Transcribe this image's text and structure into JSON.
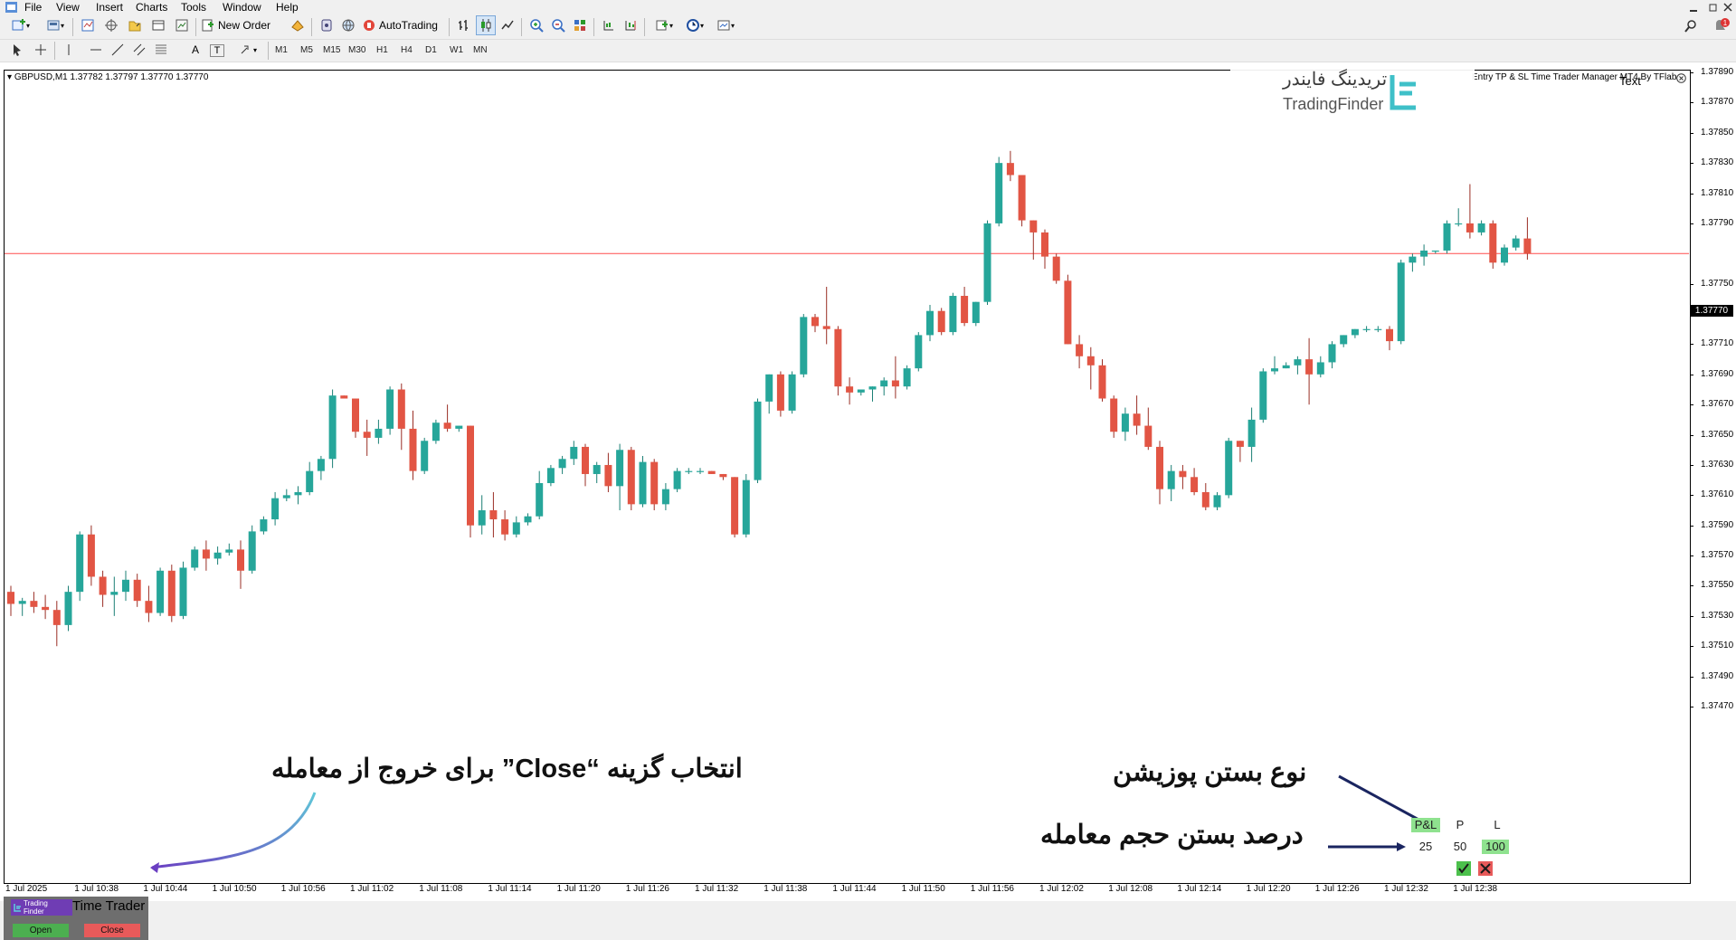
{
  "menu": [
    "File",
    "View",
    "Insert",
    "Charts",
    "Tools",
    "Window",
    "Help"
  ],
  "toolbar": {
    "new_order": "New Order",
    "autotrading": "AutoTrading",
    "draw_text_a": "A",
    "draw_text_t": "T"
  },
  "timeframes": [
    "M1",
    "M5",
    "M15",
    "M30",
    "H1",
    "H4",
    "D1",
    "W1",
    "MN"
  ],
  "chart": {
    "symbol_header": "GBPUSD,M1  1.37782 1.37797 1.37770 1.37770",
    "indicator_name": "Entry TP & SL Time Trader Manager MT4 By TFlab",
    "text_label": "Text",
    "current_price": "1.37770",
    "price_line_color": "#ff4d4d",
    "bull_color": "#26a69a",
    "bear_color": "#e25544",
    "y_labels": [
      "1.37890",
      "1.37870",
      "1.37850",
      "1.37830",
      "1.37810",
      "1.37790",
      "1.37750",
      "1.37730",
      "1.37710",
      "1.37690",
      "1.37670",
      "1.37650",
      "1.37630",
      "1.37610",
      "1.37590",
      "1.37570",
      "1.37550",
      "1.37530",
      "1.37510",
      "1.37490",
      "1.37470"
    ],
    "x_labels": [
      "1 Jul 2025",
      "1 Jul 10:38",
      "1 Jul 10:44",
      "1 Jul 10:50",
      "1 Jul 10:56",
      "1 Jul 11:02",
      "1 Jul 11:08",
      "1 Jul 11:14",
      "1 Jul 11:20",
      "1 Jul 11:26",
      "1 Jul 11:32",
      "1 Jul 11:38",
      "1 Jul 11:44",
      "1 Jul 11:50",
      "1 Jul 11:56",
      "1 Jul 12:02",
      "1 Jul 12:08",
      "1 Jul 12:14",
      "1 Jul 12:20",
      "1 Jul 12:26",
      "1 Jul 12:32",
      "1 Jul 12:38"
    ]
  },
  "chart_data": {
    "type": "candlestick",
    "candles": [
      [
        1.37546,
        1.3755,
        1.3753,
        1.37538
      ],
      [
        1.37538,
        1.37542,
        1.3753,
        1.3754
      ],
      [
        1.3754,
        1.37546,
        1.37532,
        1.37536
      ],
      [
        1.37536,
        1.37544,
        1.37528,
        1.37534
      ],
      [
        1.37534,
        1.3754,
        1.3751,
        1.37524
      ],
      [
        1.37524,
        1.3755,
        1.3752,
        1.37546
      ],
      [
        1.37546,
        1.37586,
        1.3754,
        1.37584
      ],
      [
        1.37584,
        1.3759,
        1.3755,
        1.37556
      ],
      [
        1.37556,
        1.3756,
        1.37536,
        1.37544
      ],
      [
        1.37544,
        1.37556,
        1.3753,
        1.37546
      ],
      [
        1.37546,
        1.3756,
        1.3754,
        1.37554
      ],
      [
        1.37554,
        1.37558,
        1.37536,
        1.3754
      ],
      [
        1.3754,
        1.3755,
        1.37526,
        1.37532
      ],
      [
        1.37532,
        1.37562,
        1.3753,
        1.3756
      ],
      [
        1.3756,
        1.37564,
        1.37526,
        1.3753
      ],
      [
        1.3753,
        1.37566,
        1.37528,
        1.37562
      ],
      [
        1.37562,
        1.37576,
        1.3756,
        1.37574
      ],
      [
        1.37574,
        1.3758,
        1.3756,
        1.37568
      ],
      [
        1.37568,
        1.37576,
        1.37564,
        1.37572
      ],
      [
        1.37572,
        1.37578,
        1.3757,
        1.37574
      ],
      [
        1.37574,
        1.3758,
        1.37548,
        1.3756
      ],
      [
        1.3756,
        1.3759,
        1.37558,
        1.37586
      ],
      [
        1.37586,
        1.37596,
        1.37584,
        1.37594
      ],
      [
        1.37594,
        1.37612,
        1.3759,
        1.37608
      ],
      [
        1.37608,
        1.37614,
        1.37606,
        1.3761
      ],
      [
        1.3761,
        1.37616,
        1.37604,
        1.37612
      ],
      [
        1.37612,
        1.37632,
        1.3761,
        1.37626
      ],
      [
        1.37626,
        1.37636,
        1.3762,
        1.37634
      ],
      [
        1.37634,
        1.3768,
        1.37628,
        1.37676
      ],
      [
        1.37676,
        1.37676,
        1.37674,
        1.37674
      ],
      [
        1.37674,
        1.37674,
        1.37648,
        1.37652
      ],
      [
        1.37652,
        1.3766,
        1.37636,
        1.37648
      ],
      [
        1.37648,
        1.3766,
        1.37644,
        1.37654
      ],
      [
        1.37654,
        1.37682,
        1.3765,
        1.3768
      ],
      [
        1.3768,
        1.37684,
        1.3764,
        1.37654
      ],
      [
        1.37654,
        1.37666,
        1.3762,
        1.37626
      ],
      [
        1.37626,
        1.37648,
        1.37624,
        1.37646
      ],
      [
        1.37646,
        1.3766,
        1.37644,
        1.37658
      ],
      [
        1.37658,
        1.3767,
        1.37652,
        1.37654
      ],
      [
        1.37654,
        1.37656,
        1.37652,
        1.37656
      ],
      [
        1.37656,
        1.37656,
        1.37582,
        1.3759
      ],
      [
        1.3759,
        1.3761,
        1.37584,
        1.376
      ],
      [
        1.376,
        1.37612,
        1.37582,
        1.37594
      ],
      [
        1.37594,
        1.376,
        1.3758,
        1.37584
      ],
      [
        1.37584,
        1.37596,
        1.37582,
        1.37592
      ],
      [
        1.37592,
        1.37598,
        1.3759,
        1.37596
      ],
      [
        1.37596,
        1.37626,
        1.37594,
        1.37618
      ],
      [
        1.37618,
        1.3763,
        1.37616,
        1.37628
      ],
      [
        1.37628,
        1.37636,
        1.37624,
        1.37634
      ],
      [
        1.37634,
        1.37646,
        1.3763,
        1.37642
      ],
      [
        1.37642,
        1.37644,
        1.37616,
        1.37624
      ],
      [
        1.37624,
        1.37632,
        1.37618,
        1.3763
      ],
      [
        1.3763,
        1.37638,
        1.37612,
        1.37616
      ],
      [
        1.37616,
        1.37644,
        1.376,
        1.3764
      ],
      [
        1.3764,
        1.37642,
        1.376,
        1.37604
      ],
      [
        1.37604,
        1.37636,
        1.37602,
        1.37632
      ],
      [
        1.37632,
        1.37634,
        1.376,
        1.37604
      ],
      [
        1.37604,
        1.37618,
        1.376,
        1.37614
      ],
      [
        1.37614,
        1.37628,
        1.37612,
        1.37626
      ],
      [
        1.37626,
        1.37628,
        1.37624,
        1.37626
      ],
      [
        1.37626,
        1.37628,
        1.37624,
        1.37626
      ],
      [
        1.37626,
        1.37626,
        1.37624,
        1.37624
      ],
      [
        1.37624,
        1.37624,
        1.3762,
        1.37622
      ],
      [
        1.37622,
        1.37622,
        1.37582,
        1.37584
      ],
      [
        1.37584,
        1.37624,
        1.37582,
        1.3762
      ],
      [
        1.3762,
        1.37674,
        1.37618,
        1.37672
      ],
      [
        1.37672,
        1.3769,
        1.37664,
        1.3769
      ],
      [
        1.3769,
        1.37692,
        1.37662,
        1.37666
      ],
      [
        1.37666,
        1.37692,
        1.37664,
        1.3769
      ],
      [
        1.3769,
        1.3773,
        1.37688,
        1.37728
      ],
      [
        1.37728,
        1.3773,
        1.37718,
        1.37722
      ],
      [
        1.37722,
        1.37748,
        1.3771,
        1.3772
      ],
      [
        1.3772,
        1.37722,
        1.37676,
        1.37682
      ],
      [
        1.37682,
        1.37688,
        1.3767,
        1.37678
      ],
      [
        1.37678,
        1.3768,
        1.37676,
        1.3768
      ],
      [
        1.3768,
        1.37682,
        1.37672,
        1.37682
      ],
      [
        1.37682,
        1.37688,
        1.37676,
        1.37686
      ],
      [
        1.37686,
        1.37702,
        1.37674,
        1.37682
      ],
      [
        1.37682,
        1.37696,
        1.3768,
        1.37694
      ],
      [
        1.37694,
        1.37718,
        1.37692,
        1.37716
      ],
      [
        1.37716,
        1.37736,
        1.37712,
        1.37732
      ],
      [
        1.37732,
        1.37734,
        1.37716,
        1.37718
      ],
      [
        1.37718,
        1.37744,
        1.37716,
        1.37742
      ],
      [
        1.37742,
        1.37748,
        1.37722,
        1.37724
      ],
      [
        1.37724,
        1.37738,
        1.37722,
        1.37738
      ],
      [
        1.37738,
        1.37792,
        1.37736,
        1.3779
      ],
      [
        1.3779,
        1.37834,
        1.37788,
        1.3783
      ],
      [
        1.3783,
        1.37838,
        1.37818,
        1.37822
      ],
      [
        1.37822,
        1.37822,
        1.37788,
        1.37792
      ],
      [
        1.37792,
        1.37792,
        1.37766,
        1.37784
      ],
      [
        1.37784,
        1.37786,
        1.3776,
        1.37768
      ],
      [
        1.37768,
        1.3777,
        1.3775,
        1.37752
      ],
      [
        1.37752,
        1.37756,
        1.3771,
        1.3771
      ],
      [
        1.3771,
        1.37716,
        1.37694,
        1.37702
      ],
      [
        1.37702,
        1.37708,
        1.3768,
        1.37696
      ],
      [
        1.37696,
        1.377,
        1.37672,
        1.37674
      ],
      [
        1.37674,
        1.37676,
        1.37648,
        1.37652
      ],
      [
        1.37652,
        1.37668,
        1.37646,
        1.37664
      ],
      [
        1.37664,
        1.37676,
        1.3765,
        1.37656
      ],
      [
        1.37656,
        1.37668,
        1.3764,
        1.37642
      ],
      [
        1.37642,
        1.37646,
        1.37604,
        1.37614
      ],
      [
        1.37614,
        1.3763,
        1.37606,
        1.37626
      ],
      [
        1.37626,
        1.3763,
        1.37614,
        1.37622
      ],
      [
        1.37622,
        1.37628,
        1.3761,
        1.37612
      ],
      [
        1.37612,
        1.37618,
        1.376,
        1.37602
      ],
      [
        1.37602,
        1.37612,
        1.376,
        1.3761
      ],
      [
        1.3761,
        1.37648,
        1.37608,
        1.37646
      ],
      [
        1.37646,
        1.37646,
        1.37632,
        1.37642
      ],
      [
        1.37642,
        1.37668,
        1.37632,
        1.3766
      ],
      [
        1.3766,
        1.37694,
        1.37658,
        1.37692
      ],
      [
        1.37692,
        1.37702,
        1.3769,
        1.37694
      ],
      [
        1.37694,
        1.37698,
        1.37694,
        1.37696
      ],
      [
        1.37696,
        1.37702,
        1.3769,
        1.377
      ],
      [
        1.377,
        1.37714,
        1.3767,
        1.3769
      ],
      [
        1.3769,
        1.37702,
        1.37688,
        1.37698
      ],
      [
        1.37698,
        1.37712,
        1.37694,
        1.3771
      ],
      [
        1.3771,
        1.37716,
        1.37708,
        1.37716
      ],
      [
        1.37716,
        1.3772,
        1.37714,
        1.3772
      ],
      [
        1.3772,
        1.37722,
        1.37718,
        1.3772
      ],
      [
        1.3772,
        1.37722,
        1.37718,
        1.3772
      ],
      [
        1.3772,
        1.37722,
        1.37706,
        1.37712
      ],
      [
        1.37712,
        1.37766,
        1.3771,
        1.37764
      ],
      [
        1.37764,
        1.3777,
        1.37758,
        1.37768
      ],
      [
        1.37768,
        1.37776,
        1.37762,
        1.37772
      ],
      [
        1.37772,
        1.37772,
        1.3777,
        1.37772
      ],
      [
        1.37772,
        1.37792,
        1.3777,
        1.3779
      ],
      [
        1.3779,
        1.378,
        1.37788,
        1.3779
      ],
      [
        1.3779,
        1.37816,
        1.3778,
        1.37784
      ],
      [
        1.37784,
        1.37792,
        1.37782,
        1.3779
      ],
      [
        1.3779,
        1.37792,
        1.3776,
        1.37764
      ],
      [
        1.37764,
        1.37776,
        1.37762,
        1.37774
      ],
      [
        1.37774,
        1.37782,
        1.37772,
        1.3778
      ],
      [
        1.3778,
        1.37794,
        1.37766,
        1.3777
      ]
    ]
  },
  "watermark": {
    "persian": "تریدینگ فایندر",
    "english": "TradingFinder"
  },
  "annotations": {
    "close_option": "انتخاب گزینه “Close” برای خروج از معامله",
    "close_type": "نوع بستن پوزیشن",
    "close_percent": "درصد بستن حجم معامله"
  },
  "panel": {
    "logo_line1": "Trading",
    "logo_line2": "Finder",
    "title": "Time Trader",
    "open_label": "Open",
    "close_label": "Close",
    "open_color": "#4caf50",
    "close_color": "#e85a5a"
  },
  "right_panel": {
    "headers": [
      "P&L",
      "P",
      "L"
    ],
    "values": [
      "25",
      "50",
      "100"
    ],
    "highlight_color": "#8fe28f"
  }
}
